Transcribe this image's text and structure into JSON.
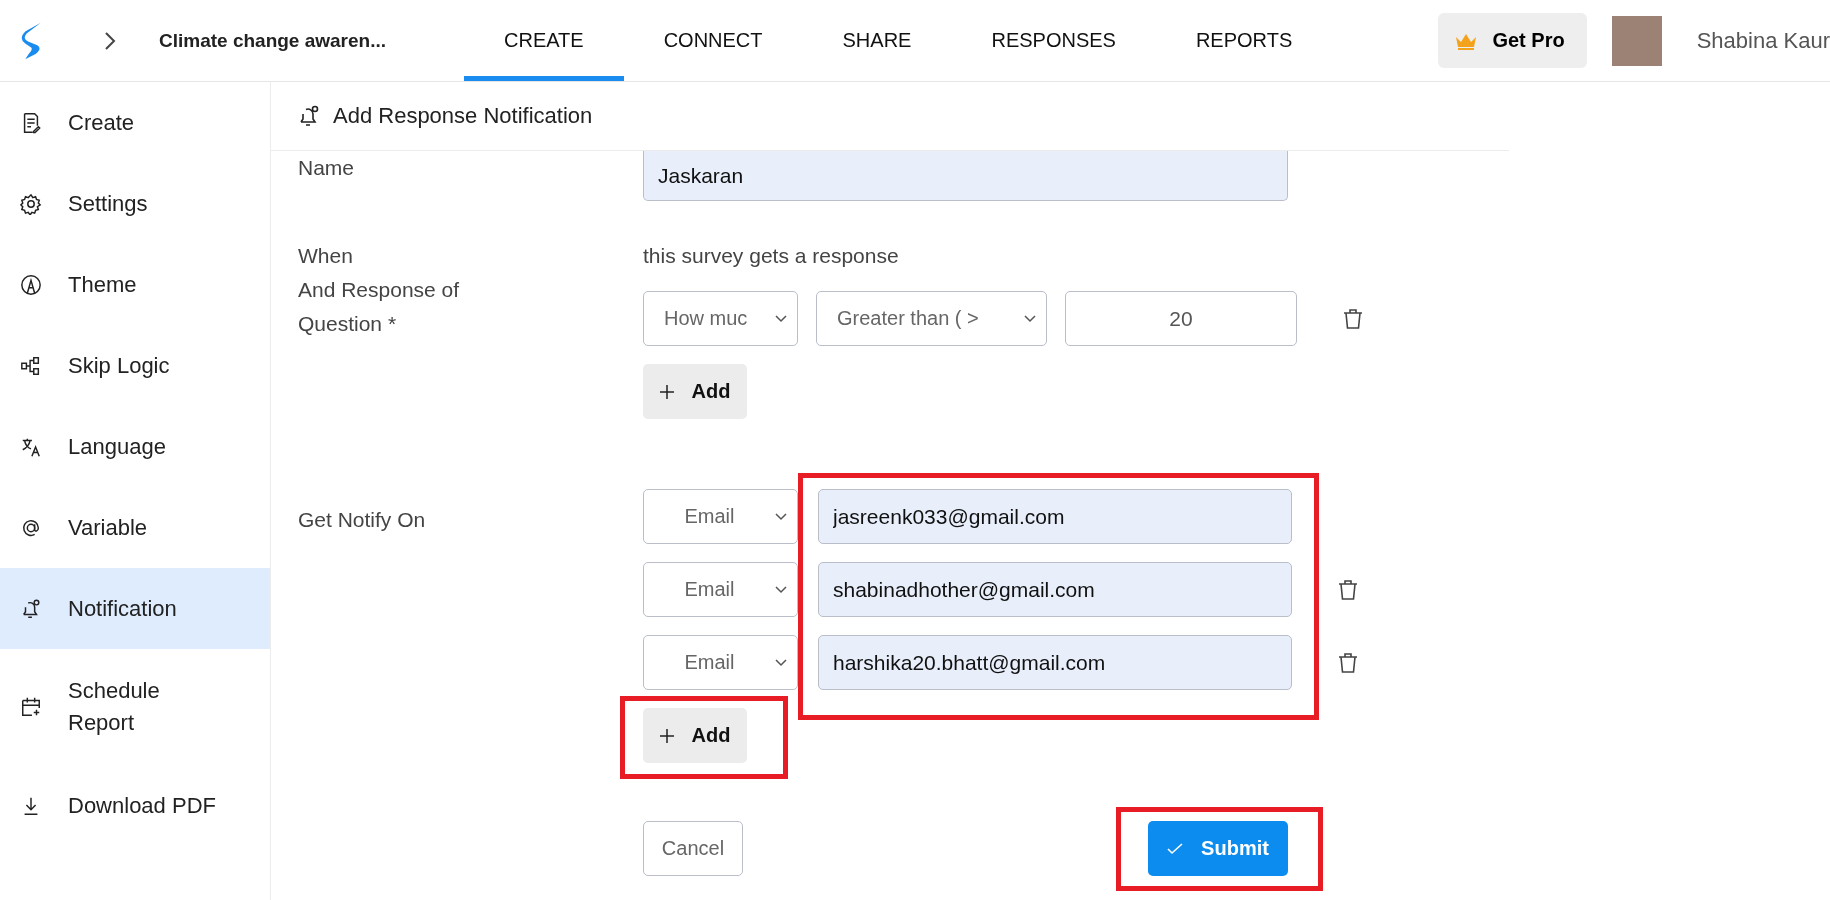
{
  "header": {
    "survey_title": "Climate change awaren...",
    "tabs": [
      {
        "label": "CREATE",
        "selected": true
      },
      {
        "label": "CONNECT",
        "selected": false
      },
      {
        "label": "SHARE",
        "selected": false
      },
      {
        "label": "RESPONSES",
        "selected": false
      },
      {
        "label": "REPORTS",
        "selected": false
      }
    ],
    "get_pro": "Get Pro",
    "user_name": "Shabina Kaur"
  },
  "sidebar": {
    "items": [
      {
        "label": "Create",
        "selected": false
      },
      {
        "label": "Settings",
        "selected": false
      },
      {
        "label": "Theme",
        "selected": false
      },
      {
        "label": "Skip Logic",
        "selected": false
      },
      {
        "label": "Language",
        "selected": false
      },
      {
        "label": "Variable",
        "selected": false
      },
      {
        "label": "Notification",
        "selected": true
      },
      {
        "label": "Schedule Report",
        "selected": false
      },
      {
        "label": "Download PDF",
        "selected": false
      }
    ]
  },
  "panel": {
    "title": "Add Response Notification",
    "name": {
      "label": "Name",
      "value": "Jaskaran"
    },
    "when": {
      "label": "When",
      "text": "this survey gets a response"
    },
    "conditions": {
      "label": "And Response of Question *",
      "rows": [
        {
          "question": "How muc",
          "operator": "Greater than ( >",
          "value": "20",
          "deletable": true
        }
      ],
      "add_button": {
        "label": "Add"
      }
    },
    "notify": {
      "label": "Get Notify On",
      "highlighted": true,
      "rows": [
        {
          "channel": "Email",
          "address": "jasreenk033@gmail.com",
          "deletable": false
        },
        {
          "channel": "Email",
          "address": "shabinadhother@gmail.com",
          "deletable": true
        },
        {
          "channel": "Email",
          "address": "harshika20.bhatt@gmail.com",
          "deletable": true
        }
      ],
      "add_button": {
        "label": "Add",
        "highlighted": true
      }
    },
    "cancel": {
      "label": "Cancel"
    },
    "submit": {
      "label": "Submit",
      "highlighted": true
    }
  }
}
